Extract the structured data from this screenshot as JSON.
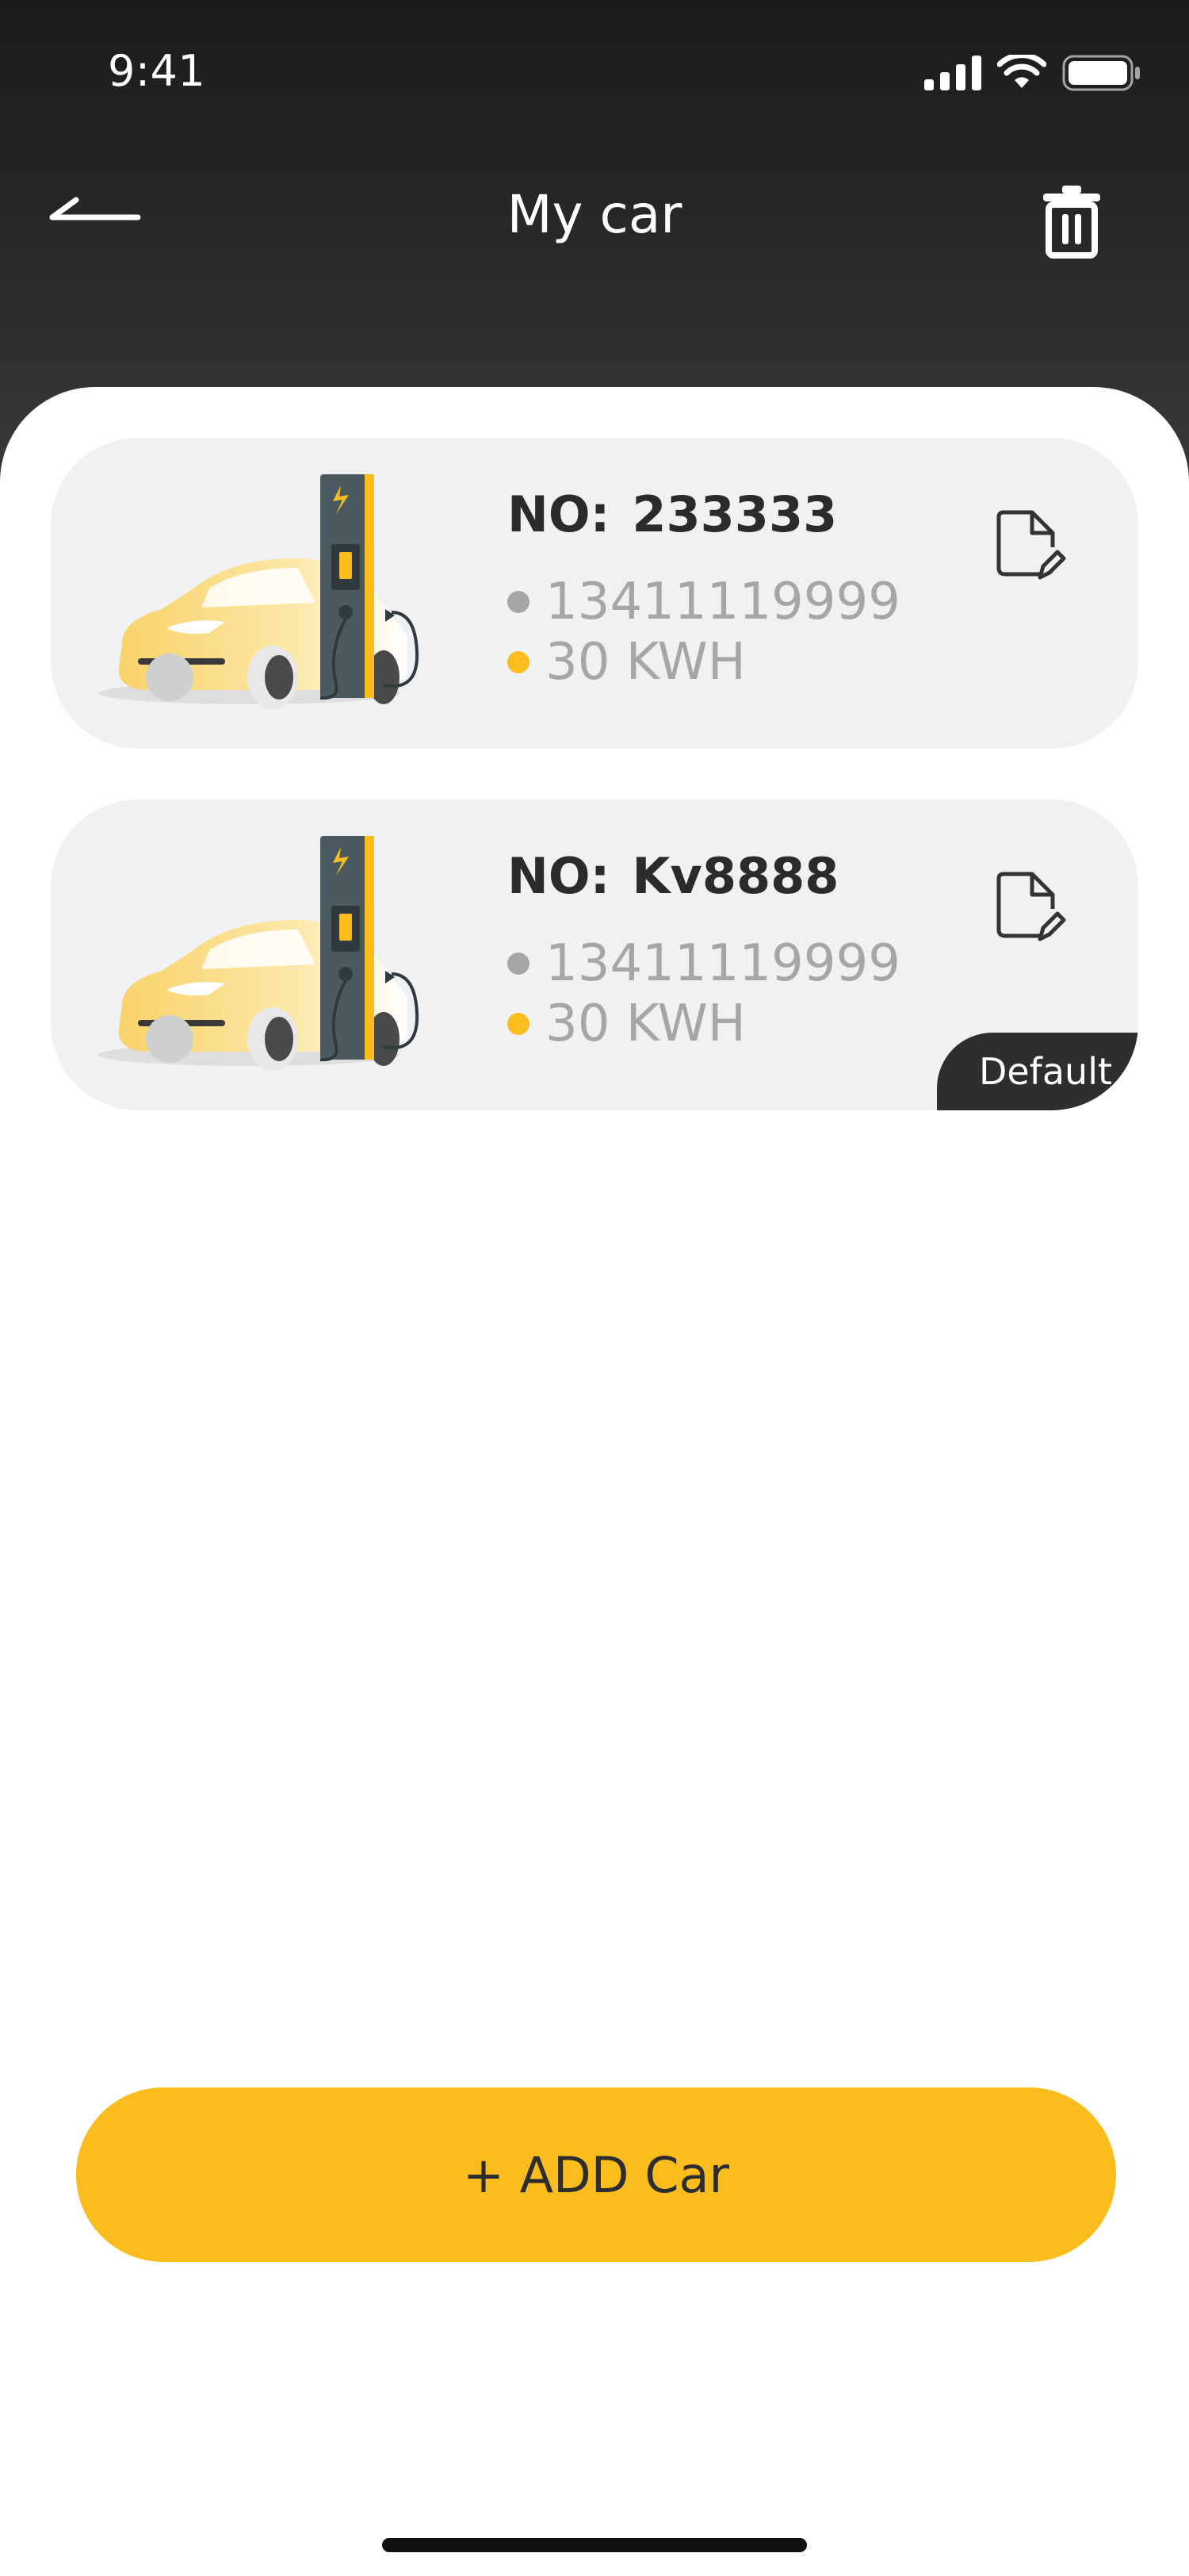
{
  "status_bar": {
    "time": "9:41"
  },
  "header": {
    "title": "My car"
  },
  "cars": [
    {
      "label": "NO:",
      "plate": "233333",
      "phone": "13411119999",
      "capacity": "30 KWH",
      "is_default": false
    },
    {
      "label": "NO:",
      "plate": "Kv8888",
      "phone": "13411119999",
      "capacity": "30 KWH",
      "is_default": true,
      "badge": "Default"
    }
  ],
  "actions": {
    "add_car_label": "+ ADD Car"
  },
  "icons": {
    "back": "back-arrow-icon",
    "delete": "trash-icon",
    "edit": "edit-document-icon",
    "signal": "cellular-signal-icon",
    "wifi": "wifi-icon",
    "battery": "battery-icon"
  },
  "colors": {
    "accent": "#fbbd1e",
    "header_bg": "#2b2b2b",
    "card_bg": "#f0f1f2",
    "badge_bg": "#2e2e2e"
  }
}
